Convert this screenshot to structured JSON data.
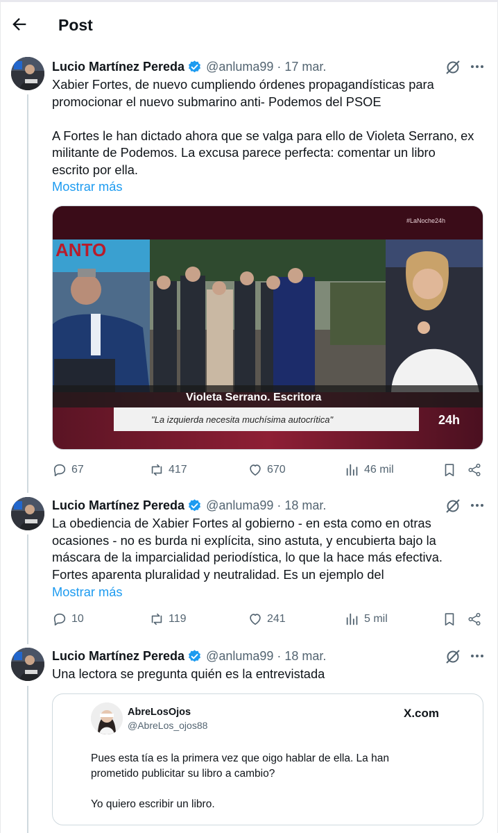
{
  "header": {
    "title": "Post"
  },
  "posts": [
    {
      "author": "Lucio Martínez Pereda",
      "handle": "@anluma99",
      "date": "17 mar.",
      "lines": [
        "Xabier Fortes, de nuevo cumpliendo órdenes propagandísticas para",
        "promocionar el nuevo submarino anti- Podemos del PSOE",
        "",
        "A Fortes le han dictado ahora que se valga para ello de Violeta Serrano, ex",
        "militante de Podemos. La excusa parece perfecta: comentar un libro",
        "escrito por ella."
      ],
      "show_more": "Mostrar más",
      "media": {
        "hashtag": "#LaNoche24h",
        "caption_name": "Violeta Serrano. Escritora",
        "caption_quote": "\"La izquierda necesita muchísima autocrítica\"",
        "channel": "24h",
        "banner_text": "ANTO"
      },
      "stats": {
        "replies": "67",
        "reposts": "417",
        "likes": "670",
        "views": "46 mil"
      }
    },
    {
      "author": "Lucio Martínez Pereda",
      "handle": "@anluma99",
      "date": "18 mar.",
      "lines": [
        "La obediencia de Xabier Fortes al gobierno - en esta como en otras",
        "ocasiones - no es burda ni explícita, sino astuta, y encubierta bajo la",
        "máscara de la imparcialidad periodística, lo que la hace más efectiva.",
        "Fortes aparenta pluralidad y neutralidad. Es un ejemplo del"
      ],
      "show_more": "Mostrar más",
      "stats": {
        "replies": "10",
        "reposts": "119",
        "likes": "241",
        "views": "5 mil"
      }
    },
    {
      "author": "Lucio Martínez Pereda",
      "handle": "@anluma99",
      "date": "18 mar.",
      "lines": [
        "Una lectora se pregunta quién es la entrevistada"
      ],
      "quote": {
        "name": "AbreLosOjos",
        "handle": "@AbreLos_ojos88",
        "site": "X.com",
        "lines": [
          "Pues esta tía es la primera vez que oigo hablar de ella.  La han",
          "prometido publicitar su libro a cambio?",
          "",
          "Yo quiero escribir un libro."
        ]
      }
    }
  ],
  "colors": {
    "accent": "#1d9bf0",
    "muted": "#536471",
    "border": "#cfd9de"
  },
  "icons": [
    "back-arrow-icon",
    "verified-badge-icon",
    "grok-icon",
    "more-icon",
    "reply-icon",
    "repost-icon",
    "like-icon",
    "views-icon",
    "bookmark-icon",
    "share-icon"
  ]
}
